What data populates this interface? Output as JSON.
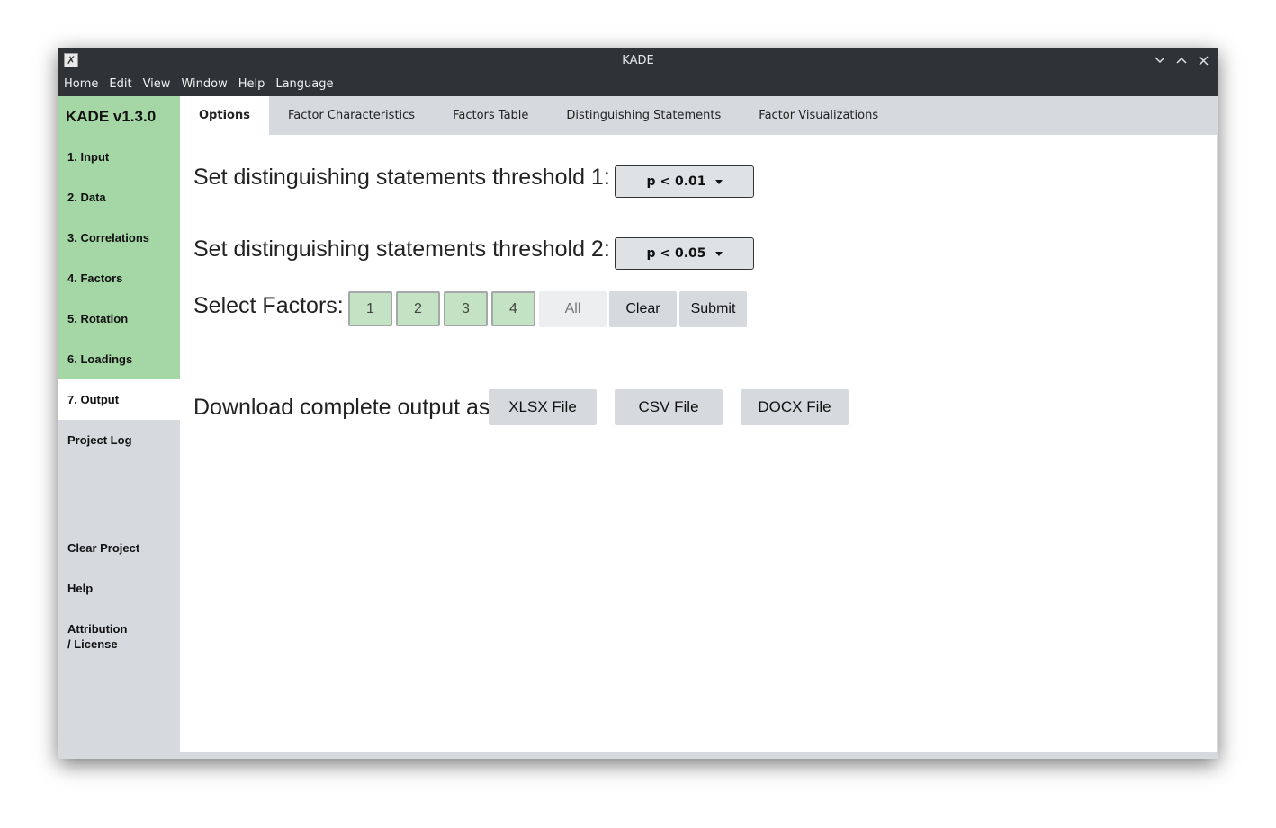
{
  "window": {
    "title": "KADE"
  },
  "menu": [
    "Home",
    "Edit",
    "View",
    "Window",
    "Help",
    "Language"
  ],
  "sidebar": {
    "brand": "KADE v1.3.0",
    "steps": [
      "1. Input",
      "2. Data",
      "3. Correlations",
      "4. Factors",
      "5. Rotation",
      "6. Loadings",
      "7. Output",
      "Project Log"
    ],
    "active_step": "7. Output",
    "bottom": {
      "clear_project": "Clear Project",
      "help": "Help",
      "attribution_line1": "Attribution",
      "attribution_line2": "/ License"
    }
  },
  "tabs": [
    "Options",
    "Factor Characteristics",
    "Factors Table",
    "Distinguishing Statements",
    "Factor Visualizations"
  ],
  "active_tab": "Options",
  "options": {
    "threshold1_label": "Set distinguishing statements threshold 1:",
    "threshold1_value": "p < 0.01",
    "threshold2_label": "Set distinguishing statements threshold 2:",
    "threshold2_value": "p < 0.05",
    "select_factors_label": "Select Factors:",
    "factors": [
      "1",
      "2",
      "3",
      "4"
    ],
    "all_label": "All",
    "clear_label": "Clear",
    "submit_label": "Submit",
    "download_label": "Download complete output as:",
    "xlsx_label": "XLSX File",
    "csv_label": "CSV File",
    "docx_label": "DOCX File"
  },
  "colors": {
    "accent_green": "#a4d7a5",
    "factor_selected": "#c3e3c4",
    "titlebar": "#2f3337",
    "panel_gray": "#d6d9dd"
  }
}
